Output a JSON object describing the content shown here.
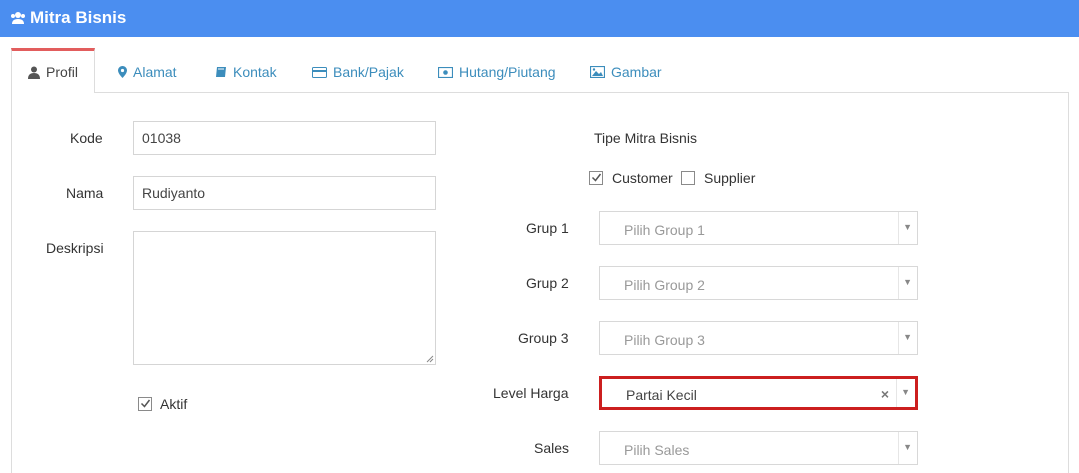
{
  "header": {
    "title": "Mitra Bisnis",
    "icon": "users-icon"
  },
  "tabs": [
    {
      "label": "Profil",
      "icon": "user-icon",
      "active": true
    },
    {
      "label": "Alamat",
      "icon": "map-marker-icon"
    },
    {
      "label": "Kontak",
      "icon": "book-icon"
    },
    {
      "label": "Bank/Pajak",
      "icon": "credit-card-icon"
    },
    {
      "label": "Hutang/Piutang",
      "icon": "money-icon"
    },
    {
      "label": "Gambar",
      "icon": "image-icon"
    }
  ],
  "form": {
    "kode_label": "Kode",
    "kode_value": "01038",
    "nama_label": "Nama",
    "nama_value": "Rudiyanto",
    "deskripsi_label": "Deskripsi",
    "deskripsi_value": "",
    "aktif_label": "Aktif",
    "aktif_checked": true,
    "tipe_label": "Tipe Mitra Bisnis",
    "customer_label": "Customer",
    "customer_checked": true,
    "supplier_label": "Supplier",
    "supplier_checked": false,
    "grup1_label": "Grup 1",
    "grup1_placeholder": "Pilih Group 1",
    "grup2_label": "Grup 2",
    "grup2_placeholder": "Pilih Group 2",
    "group3_label": "Group 3",
    "group3_placeholder": "Pilih Group 3",
    "level_label": "Level Harga",
    "level_value": "Partai Kecil",
    "sales_label": "Sales",
    "sales_placeholder": "Pilih Sales"
  },
  "colors": {
    "header_bg": "#4b8ef0",
    "active_tab_border": "#e25d5d",
    "highlight": "#cc1f1f",
    "link": "#3c8dbc"
  }
}
